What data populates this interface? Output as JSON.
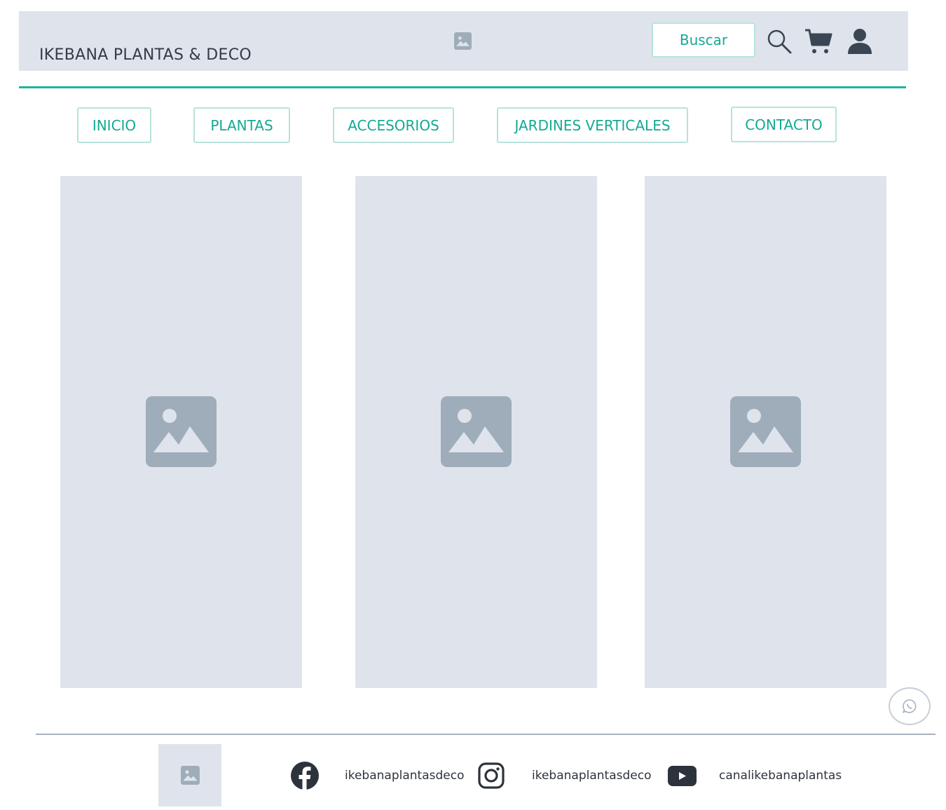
{
  "header": {
    "brand": "IKEBANA PLANTAS & DECO",
    "search_button": "Buscar"
  },
  "nav": {
    "items": [
      "INICIO",
      "PLANTAS",
      "ACCESORIOS",
      "JARDINES VERTICALES",
      "CONTACTO"
    ]
  },
  "icons": {
    "header": [
      "image-placeholder-icon",
      "search-icon",
      "cart-icon",
      "user-icon"
    ],
    "panels": [
      "image-placeholder-icon",
      "image-placeholder-icon",
      "image-placeholder-icon"
    ],
    "float": "whatsapp-icon",
    "footer": [
      "image-placeholder-icon",
      "facebook-icon",
      "instagram-icon",
      "youtube-icon"
    ]
  },
  "footer": {
    "facebook": "ikebanaplantasdeco",
    "instagram": "ikebanaplantasdeco",
    "youtube": "canalikebanaplantas"
  },
  "colors": {
    "accent": "#14a994",
    "placeholder_bg": "#dfe4ec",
    "icon_dark": "#3a4654",
    "placeholder_icon": "#9fadba"
  }
}
